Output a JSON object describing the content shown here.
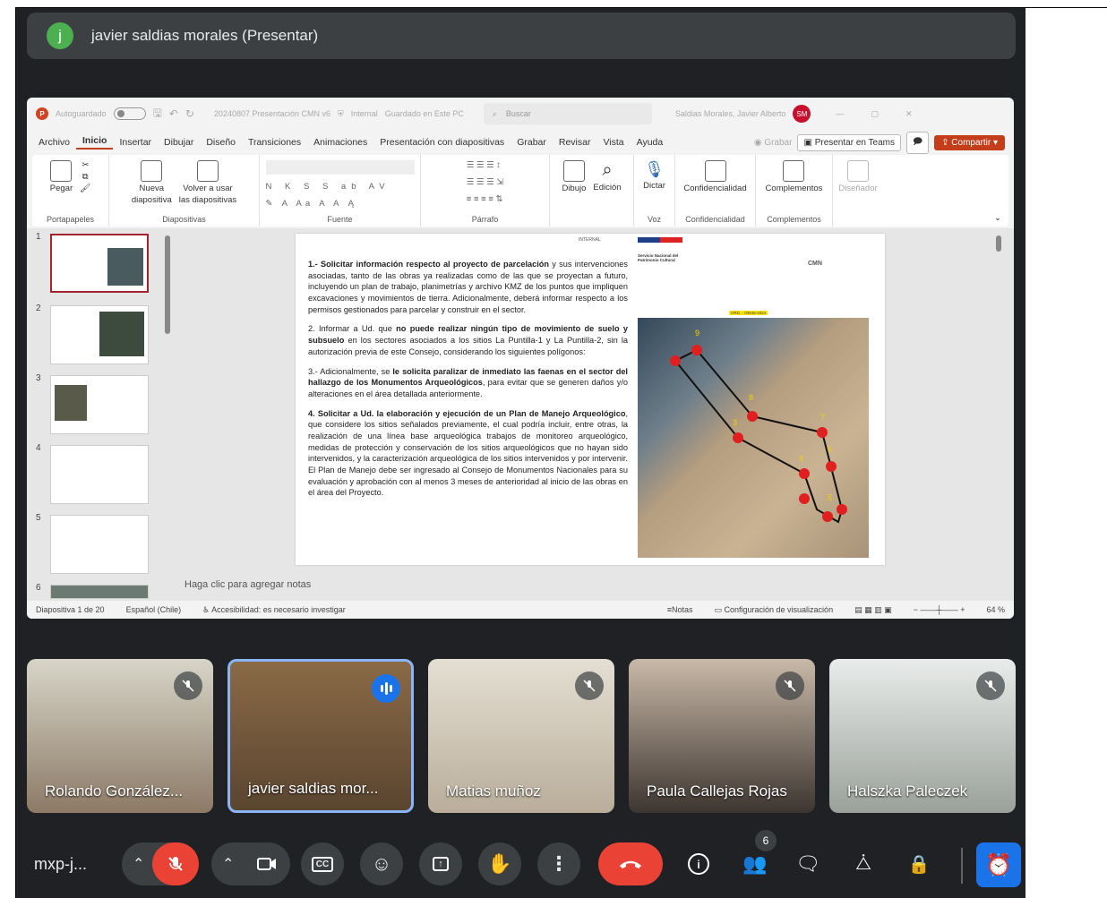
{
  "presenter": {
    "avatar": "j",
    "name": "javier saldias morales (Presentar)"
  },
  "ppt": {
    "autosave": "Autoguardado",
    "file_title": "20240807 Presentación CMN v6",
    "sensitivity": "Internal",
    "save_state": "Guardado en Este PC",
    "search_placeholder": "Buscar",
    "user_name": "Saldias Morales, Javier Alberto",
    "user_initials": "SM",
    "menu": [
      "Archivo",
      "Inicio",
      "Insertar",
      "Dibujar",
      "Diseño",
      "Transiciones",
      "Animaciones",
      "Presentación con diapositivas",
      "Grabar",
      "Revisar",
      "Vista",
      "Ayuda"
    ],
    "grabar": "Grabar",
    "present_teams": "Presentar en Teams",
    "share": "Compartir",
    "ribbon": {
      "pegar": "Pegar",
      "portapapeles": "Portapapeles",
      "nueva": "Nueva",
      "diapositiva": "diapositiva",
      "volver": "Volver a usar",
      "las_diapositivas": "las diapositivas",
      "diapositivas": "Diapositivas",
      "fuente": "Fuente",
      "parrafo": "Párrafo",
      "dibujo": "Dibujo",
      "edicion": "Edición",
      "dictar": "Dictar",
      "voz": "Voz",
      "confidencialidad": "Confidencialidad",
      "complementos": "Complementos",
      "disenador": "Diseñador"
    },
    "slide": {
      "internal": "INTERNAL",
      "org": "Servicio Nacional del Patrimonio Cultural",
      "cmn": "CMN",
      "ord": "ORD. - 03546-2024",
      "p1_lead": "1.- Solicitar información respecto al proyecto de parcelación",
      "p1": " y sus intervenciones asociadas, tanto de las obras ya realizadas como de las que se proyectan a futuro, incluyendo un plan de trabajo, planimetrías y archivo KMZ de los puntos que impliquen excavaciones y movimientos de tierra. Adicionalmente, deberá informar respecto a los permisos gestionados para parcelar y construir en el sector.",
      "p2_a": "2. Informar a Ud. que ",
      "p2_b": "no puede realizar ningún tipo de movimiento de suelo y subsuelo",
      "p2_c": " en los sectores asociados a los sitios La Puntilla-1 y La Puntilla-2, sin la autorización previa de este Consejo, considerando los siguientes polígonos:",
      "p3_a": "3.- Adicionalmente, se ",
      "p3_b": "le solicita paralizar de inmediato las faenas en el sector del hallazgo de los Monumentos Arqueológicos",
      "p3_c": ", para evitar que se generen daños y/o alteraciones en el área detallada anteriormente.",
      "p4_b": "4. Solicitar a Ud. la elaboración y ejecución de un Plan de Manejo Arqueológico",
      "p4_c": ", que considere los sitios señalados previamente, el cual podría incluir, entre otras, la realización de una línea base arqueológica trabajos de monitoreo arqueológico, medidas de protección y conservación de los sitios arqueológicos que no hayan sido intervenidos, y la caracterización arqueológica de los sitios intervenidos y por intervenir. El Plan de Manejo debe ser ingresado al Consejo de Monumentos Nacionales para su evaluación y aprobación con al menos 3 meses de anterioridad al inicio de las obras en el área del Proyecto."
    },
    "map_labels": [
      "9",
      "8",
      "7",
      "6",
      "5",
      "4",
      "3"
    ],
    "thumb_numbers": [
      "1",
      "2",
      "3",
      "4",
      "5",
      "6"
    ],
    "notes_placeholder": "Haga clic para agregar notas",
    "status": {
      "slide_count": "Diapositiva 1 de 20",
      "language": "Español (Chile)",
      "accessibility": "Accesibilidad: es necesario investigar",
      "notes": "Notas",
      "view_config": "Configuración de visualización",
      "zoom": "64 %"
    }
  },
  "participants": [
    {
      "name": "Rolando González...",
      "muted": true
    },
    {
      "name": "javier saldias mor...",
      "speaking": true
    },
    {
      "name": "Matias muñoz",
      "muted": true
    },
    {
      "name": "Paula Callejas Rojas",
      "muted": true
    },
    {
      "name": "Halszka Paleczek",
      "muted": true
    }
  ],
  "controls": {
    "meeting_code": "mxp-j...",
    "people_count": "6"
  },
  "colors": {
    "meet_bg": "#202124",
    "accent": "#1a73e8",
    "end_red": "#ea4335",
    "ppt_accent": "#c43e1c"
  }
}
